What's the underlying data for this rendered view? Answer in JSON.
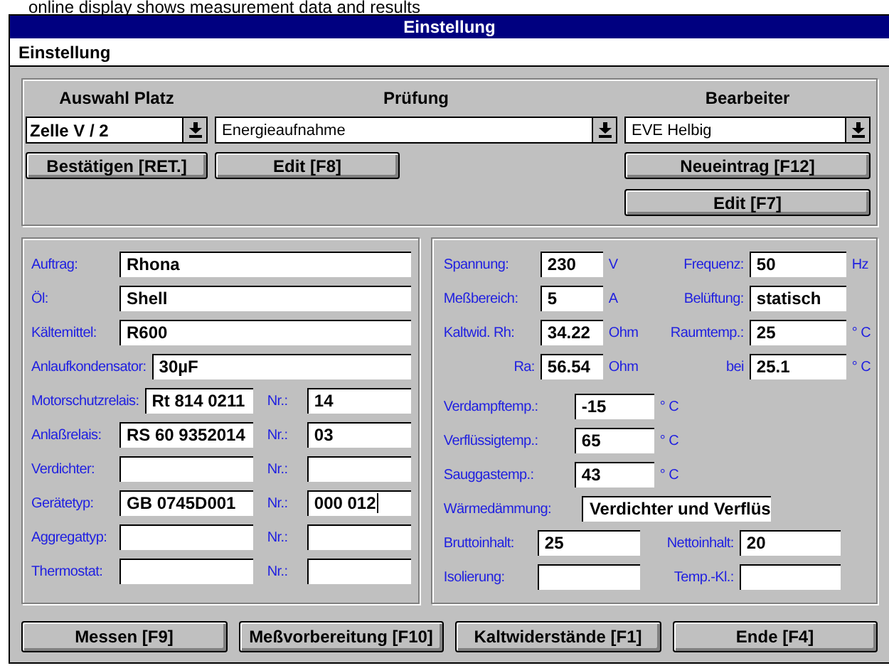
{
  "caption": "online display shows measurement data and results",
  "window": {
    "title": "Einstellung"
  },
  "menu": [
    "Einstellung"
  ],
  "selection": {
    "columns": [
      {
        "header": "Auswahl Platz",
        "value": "Zelle V / 2",
        "bold": true,
        "buttons": [
          "Bestätigen [RET.]"
        ]
      },
      {
        "header": "Prüfung",
        "value": "Energieaufnahme",
        "bold": false,
        "buttons": [
          "Edit [F8]"
        ]
      },
      {
        "header": "Bearbeiter",
        "value": "EVE Helbig",
        "bold": false,
        "buttons": [
          "Neueintrag [F12]",
          "Edit [F7]"
        ]
      }
    ]
  },
  "device": [
    {
      "kind": "single",
      "label": "Auftrag:",
      "value": "Rhona"
    },
    {
      "kind": "single",
      "label": "Öl:",
      "value": "Shell"
    },
    {
      "kind": "single",
      "label": "Kältemittel:",
      "value": "R600"
    },
    {
      "kind": "single",
      "label": "Anlaufkondensator:",
      "value": "30µF"
    },
    {
      "kind": "pair",
      "label": "Motorschutzrelais:",
      "value": "Rt 814 0211",
      "nr_label": "Nr.:",
      "nr": "14",
      "focused": false
    },
    {
      "kind": "pair",
      "label": "Anlaßrelais:",
      "value": "RS 60 9352014",
      "nr_label": "Nr.:",
      "nr": "03",
      "focused": false
    },
    {
      "kind": "pair",
      "label": "Verdichter:",
      "nr_label": "Nr.:",
      "focused": false
    },
    {
      "kind": "pair",
      "label": "Gerätetyp:",
      "value": "GB 0745D001",
      "nr_label": "Nr.:",
      "nr": "000 012",
      "focused": true
    },
    {
      "kind": "pair",
      "label": "Aggregattyp:",
      "nr_label": "Nr.:",
      "focused": false
    },
    {
      "kind": "pair",
      "label": "Thermostat:",
      "nr_label": "Nr.:",
      "focused": false
    }
  ],
  "measurements": [
    {
      "label": "Spannung:",
      "value": "230",
      "unit": "V",
      "label2": "Frequenz:",
      "value2": "50",
      "unit2": "Hz"
    },
    {
      "label": "Meßbereich:",
      "value": "5",
      "unit": "A",
      "label2": "Belüftung:",
      "value2": "statisch"
    },
    {
      "label": "Kaltwid. Rh:",
      "value": "34.22",
      "unit": "Ohm",
      "label2": "Raumtemp.:",
      "value2": "25",
      "unit2": "° C"
    },
    {
      "label": "Ra:",
      "value": "56.54",
      "unit": "Ohm",
      "label2": "bei",
      "value2": "25.1",
      "unit2": "° C"
    }
  ],
  "temperatures": [
    {
      "label": "Verdampftemp.:",
      "value": "-15",
      "unit": "° C"
    },
    {
      "label": "Verflüssigtemp.:",
      "value": "65",
      "unit": "° C"
    },
    {
      "label": "Sauggastemp.:",
      "value": "43",
      "unit": "° C"
    }
  ],
  "insulation": {
    "label": "Wärmedämmung:",
    "value": "Verdichter und Verflüs"
  },
  "volumes": [
    {
      "label": "Bruttoinhalt:",
      "value": "25",
      "label2": "Nettoinhalt:",
      "value2": "20"
    },
    {
      "label": "Isolierung:",
      "label2": "Temp.-Kl.:"
    }
  ],
  "buttons": [
    "Messen [F9]",
    "Meßvorbereitung [F10]",
    "Kaltwiderstände [F1]",
    "Ende [F4]"
  ]
}
